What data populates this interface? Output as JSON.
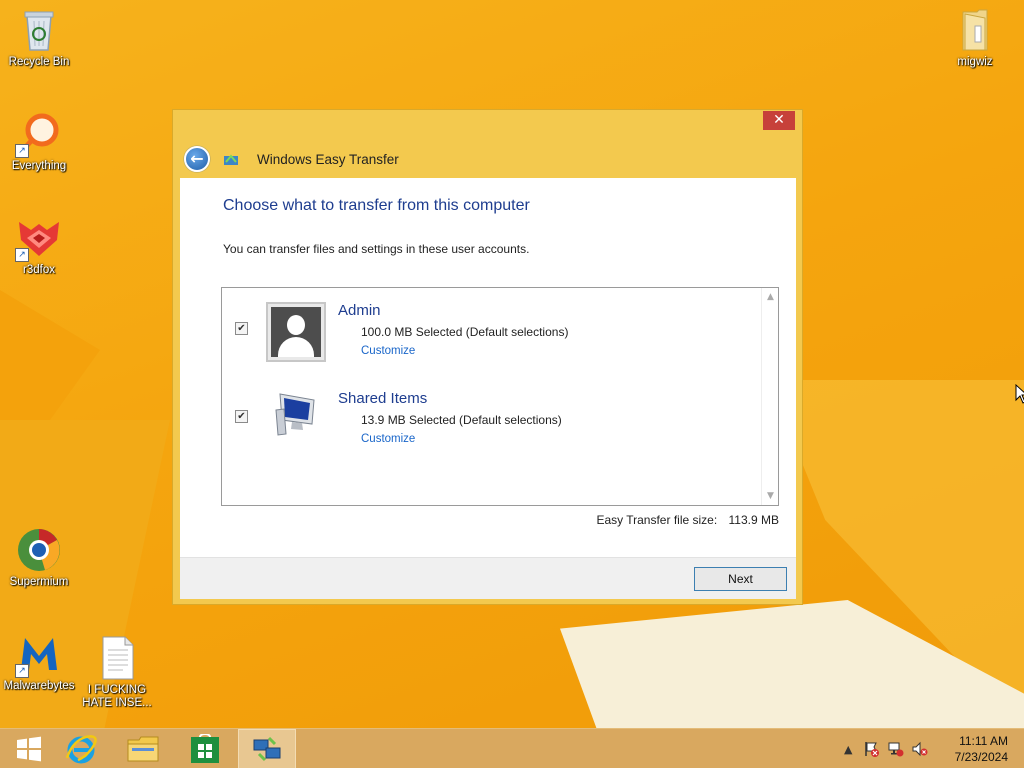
{
  "desktop": {
    "icons": [
      {
        "label": "Recycle Bin"
      },
      {
        "label": "Everything"
      },
      {
        "label": "r3dfox"
      },
      {
        "label": "Supermium"
      },
      {
        "label": "Malwarebytes"
      },
      {
        "label": "I FUCKING HATE INSE..."
      },
      {
        "label": "migwiz"
      }
    ]
  },
  "window": {
    "close_glyph": "✕",
    "title": "Windows Easy Transfer",
    "heading": "Choose what to transfer from this computer",
    "subtext": "You can transfer files and settings in these user accounts.",
    "accounts": [
      {
        "name": "Admin",
        "detail": "100.0 MB Selected (Default selections)",
        "link": "Customize",
        "checked": true
      },
      {
        "name": "Shared Items",
        "detail": "13.9 MB Selected (Default selections)",
        "link": "Customize",
        "checked": true
      }
    ],
    "size_label": "Easy Transfer file size:",
    "size_value": "113.9 MB",
    "next_label": "Next"
  },
  "taskbar": {
    "clock_time": "11:11 AM",
    "clock_date": "7/23/2024"
  },
  "colors": {
    "heading": "#1e3d8f",
    "link": "#1a66c9",
    "window_frame": "#f3c94e",
    "close_button": "#c7413a"
  }
}
